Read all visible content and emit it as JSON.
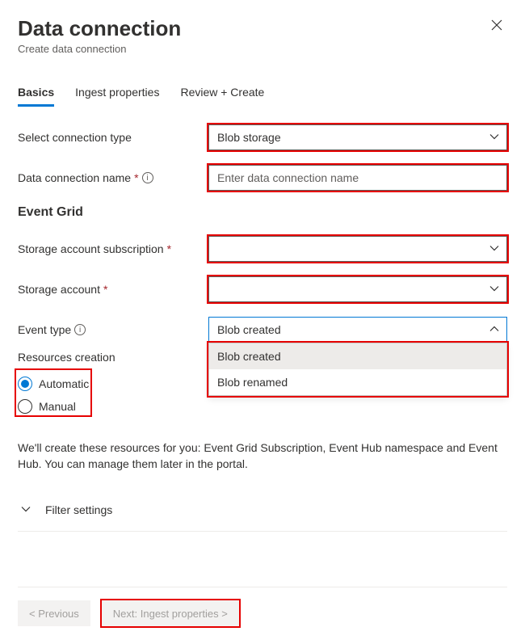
{
  "header": {
    "title": "Data connection",
    "subtitle": "Create data connection"
  },
  "tabs": {
    "basics": "Basics",
    "ingest": "Ingest properties",
    "review": "Review + Create"
  },
  "fields": {
    "connection_type": {
      "label": "Select connection type",
      "value": "Blob storage"
    },
    "connection_name": {
      "label": "Data connection name",
      "placeholder": "Enter data connection name",
      "value": ""
    },
    "event_grid_heading": "Event Grid",
    "subscription": {
      "label": "Storage account subscription",
      "value": ""
    },
    "storage_account": {
      "label": "Storage account",
      "value": ""
    },
    "event_type": {
      "label": "Event type",
      "value": "Blob created",
      "options": [
        "Blob created",
        "Blob renamed"
      ]
    },
    "resources_creation": {
      "label": "Resources creation",
      "options": [
        "Automatic",
        "Manual"
      ],
      "selected": "Automatic"
    }
  },
  "note": "We'll create these resources for you: Event Grid Subscription, Event Hub namespace and Event Hub. You can manage them later in the portal.",
  "filter_settings_label": "Filter settings",
  "footer": {
    "previous": "< Previous",
    "next": "Next: Ingest properties >"
  }
}
